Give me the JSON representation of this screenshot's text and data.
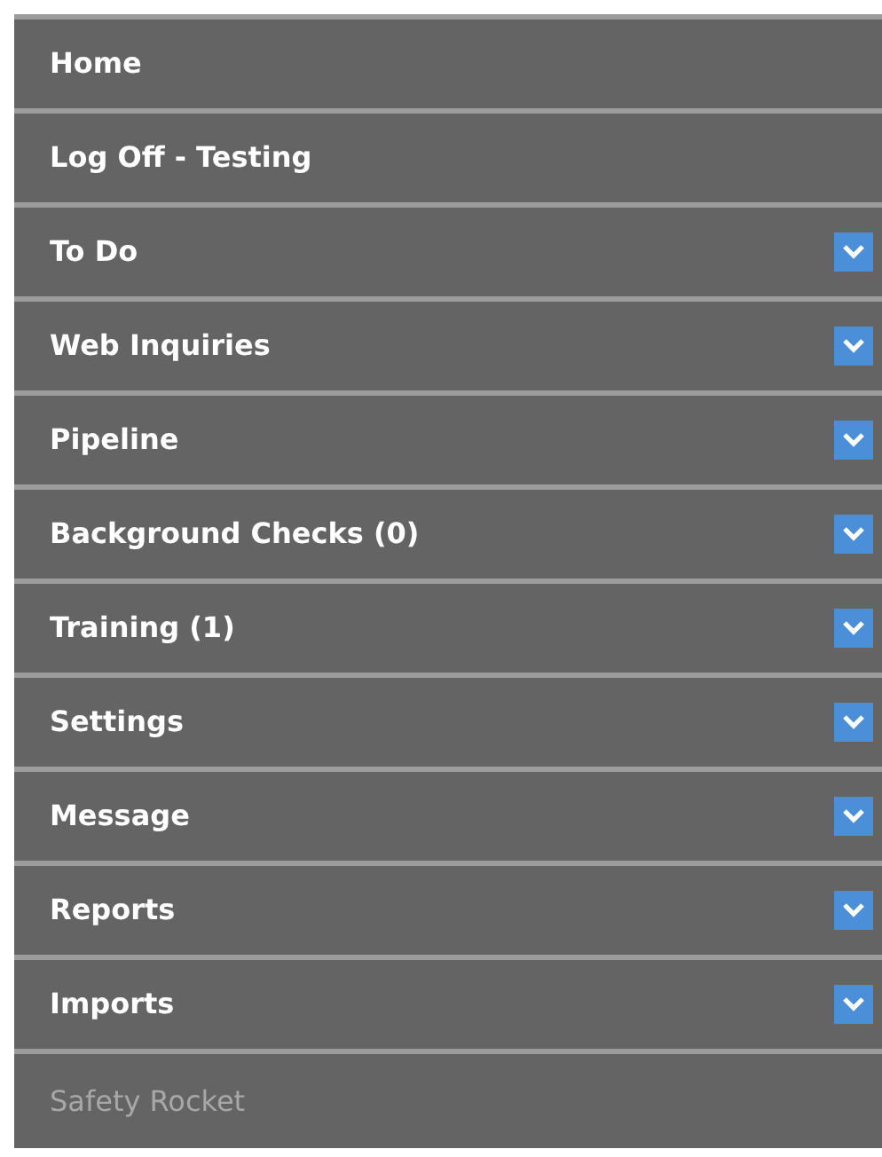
{
  "menu": [
    {
      "label": "Home",
      "expandable": false,
      "disabled": false
    },
    {
      "label": "Log Off - Testing",
      "expandable": false,
      "disabled": false
    },
    {
      "label": "To Do",
      "expandable": true,
      "disabled": false
    },
    {
      "label": "Web Inquiries",
      "expandable": true,
      "disabled": false
    },
    {
      "label": "Pipeline",
      "expandable": true,
      "disabled": false
    },
    {
      "label": "Background Checks (0)",
      "expandable": true,
      "disabled": false
    },
    {
      "label": "Training (1)",
      "expandable": true,
      "disabled": false
    },
    {
      "label": "Settings",
      "expandable": true,
      "disabled": false
    },
    {
      "label": "Message",
      "expandable": true,
      "disabled": false
    },
    {
      "label": "Reports",
      "expandable": true,
      "disabled": false
    },
    {
      "label": "Imports",
      "expandable": true,
      "disabled": false
    },
    {
      "label": "Safety Rocket",
      "expandable": false,
      "disabled": true
    }
  ]
}
